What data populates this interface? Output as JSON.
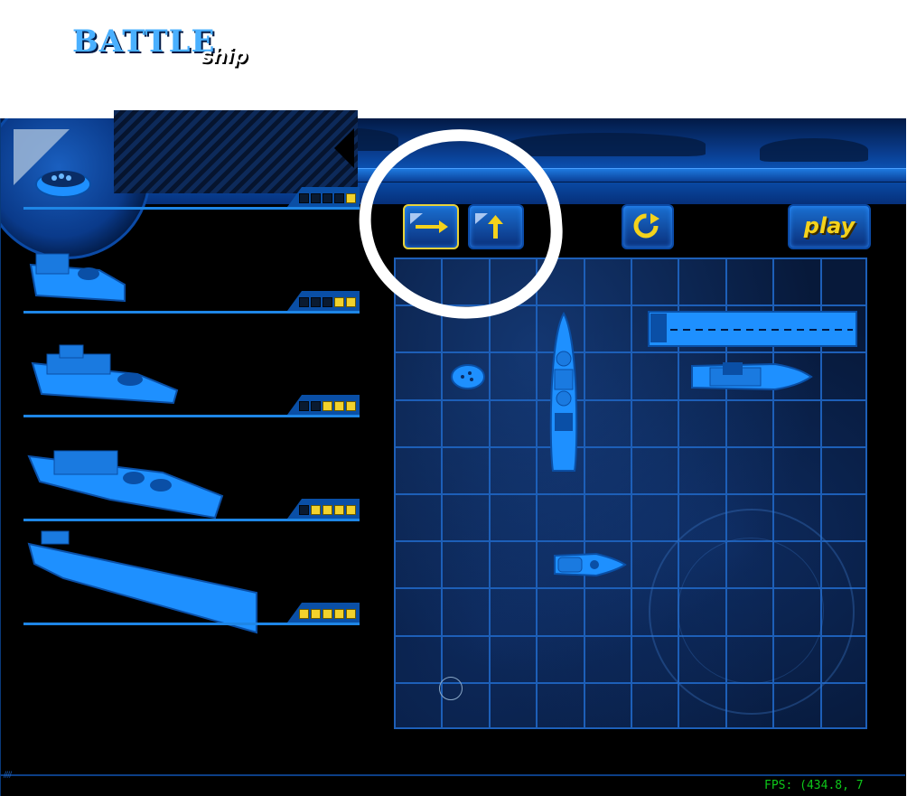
{
  "title": {
    "battle": "BATTLE",
    "ship": "ship"
  },
  "buttons": {
    "horizontal_icon": "arrow-right-icon",
    "vertical_icon": "arrow-up-icon",
    "rotate_icon": "rotate-icon",
    "play_label": "play"
  },
  "fleet": [
    {
      "name": "submarine",
      "size": 1,
      "placed": 1
    },
    {
      "name": "patrol-boat",
      "size": 2,
      "placed": 2
    },
    {
      "name": "destroyer",
      "size": 3,
      "placed": 3
    },
    {
      "name": "battleship",
      "size": 4,
      "placed": 4
    },
    {
      "name": "aircraft-carrier",
      "size": 5,
      "placed": 5
    }
  ],
  "board": {
    "rows": 10,
    "cols": 10
  },
  "fps_text": "FPS: (434.8,  7",
  "colors": {
    "accent": "#f2d22c",
    "grid": "#1d5fb8",
    "ship": "#1e90ff",
    "fps": "#0ec81a"
  }
}
